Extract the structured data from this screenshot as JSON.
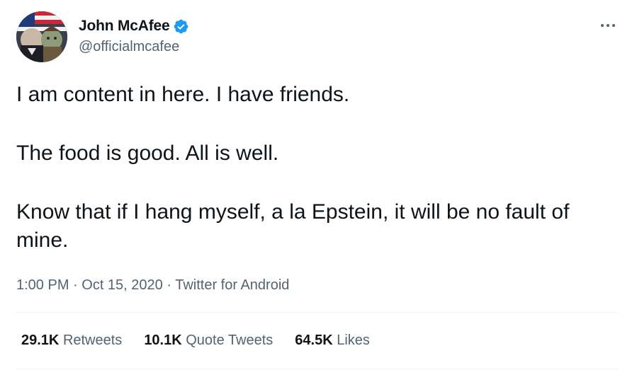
{
  "author": {
    "name": "John McAfee",
    "handle": "@officialmcafee"
  },
  "tweet": {
    "paragraphs": [
      "I am content in here. I have friends.",
      "The food is good. All is well.",
      "Know that if I hang myself, a la Epstein, it will be no fault of mine."
    ],
    "time": "1:00 PM",
    "date": "Oct 15, 2020",
    "source": "Twitter for Android",
    "separator": " · "
  },
  "stats": {
    "retweets": {
      "count": "29.1K",
      "label": "Retweets"
    },
    "quotes": {
      "count": "10.1K",
      "label": "Quote Tweets"
    },
    "likes": {
      "count": "64.5K",
      "label": "Likes"
    }
  },
  "icons": {
    "verified": "verified-badge-icon",
    "more": "more-dots-icon"
  },
  "colors": {
    "text_primary": "#0f1419",
    "text_secondary": "#536471",
    "verified_blue": "#1d9bf0",
    "divider": "#eff3f4"
  }
}
